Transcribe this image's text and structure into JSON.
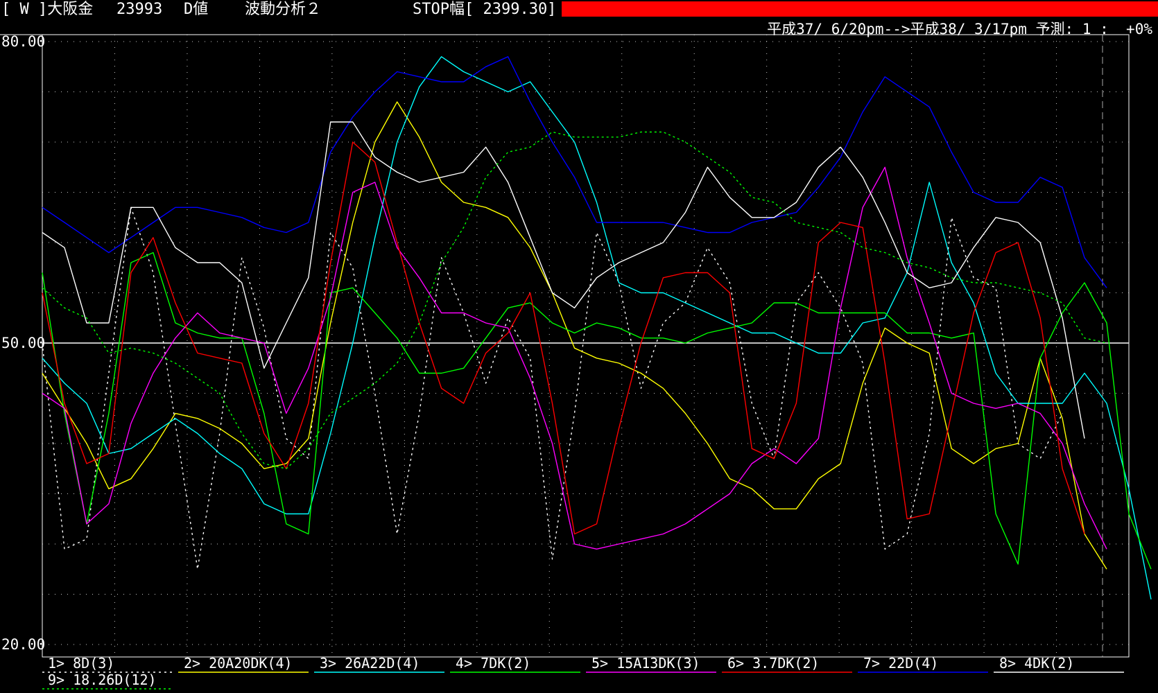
{
  "header": {
    "code": "[ W ]大阪金",
    "number": "23993",
    "mode": "D値",
    "analysis": "波動分析２",
    "stop_label": "STOP幅[ 2399.30]",
    "stop_color": "#ff0000",
    "period": "平成37/ 6/20pm-->平成38/ 3/17pm 予測: 1 :  +0%"
  },
  "chart_data": {
    "type": "line",
    "title": "",
    "xlabel": "",
    "ylabel": "",
    "ylim": [
      20,
      80
    ],
    "yticks": [
      "80.00",
      "50.00",
      "20.00"
    ],
    "reference_line": 50,
    "grid": "dotted",
    "legend_position": "bottom",
    "n_points": 50,
    "series": [
      {
        "name": "1> 8D(3)",
        "color": "#ffffff",
        "dash": "3,5",
        "values": [
          50,
          29.5,
          30.5,
          47,
          63.5,
          57,
          42,
          27.5,
          41,
          58.5,
          51.5,
          40.5,
          38.5,
          61,
          57.5,
          45,
          31,
          43,
          58.5,
          53,
          46,
          52.5,
          48.5,
          28.5,
          43,
          61,
          56,
          45.5,
          52,
          54,
          59.5,
          56,
          44,
          38.5,
          54,
          57,
          53.5,
          48,
          29.5,
          31,
          41,
          62.5,
          56.5,
          55.5,
          40,
          38.5,
          43
        ]
      },
      {
        "name": "2> 20A20DK(4)",
        "color": "#ffff00",
        "dash": "",
        "values": [
          47,
          43.5,
          40,
          35.5,
          36.5,
          39.5,
          43,
          42.5,
          41.5,
          40,
          37.5,
          38,
          40.5,
          52,
          62,
          70,
          74,
          70.5,
          66,
          64,
          63.5,
          62.5,
          59.5,
          55,
          49.5,
          48.5,
          48,
          47,
          45.5,
          43,
          40,
          36.5,
          35.5,
          33.5,
          33.5,
          36.5,
          38,
          46,
          51.5,
          50,
          49,
          39.5,
          38,
          39.5,
          40,
          48.5,
          42.5,
          31,
          27.5
        ]
      },
      {
        "name": "3> 26A22D(4)",
        "color": "#00ffff",
        "dash": "",
        "values": [
          48.5,
          46,
          44,
          39,
          39.5,
          41,
          42.5,
          41,
          39,
          37.5,
          34,
          33,
          33,
          41,
          50,
          60.5,
          70,
          75.5,
          78.5,
          77,
          76,
          75,
          76,
          73,
          70,
          64,
          56,
          55,
          55,
          54,
          53,
          52,
          51,
          51,
          50,
          49,
          49,
          52,
          52.5,
          57,
          66,
          58,
          54,
          47,
          44,
          44,
          44,
          47,
          44,
          35.5,
          24.5
        ]
      },
      {
        "name": "4> 7DK(2)",
        "color": "#00ff00",
        "dash": "",
        "values": [
          57,
          43,
          32,
          43,
          58,
          59,
          52,
          51,
          50.5,
          50.5,
          43,
          32,
          31,
          55,
          55.5,
          53,
          50.5,
          47,
          47,
          47.5,
          50.5,
          53.5,
          54,
          52,
          51,
          52,
          51.5,
          50.5,
          50.5,
          50,
          51,
          51.5,
          52,
          54,
          54,
          53,
          53,
          53,
          53,
          51,
          51,
          50.5,
          51,
          33,
          28,
          48.5,
          53,
          56,
          52,
          33,
          27.5
        ]
      },
      {
        "name": "5> 15A13DK(3)",
        "color": "#ff00ff",
        "dash": "",
        "values": [
          45,
          43.5,
          32,
          34,
          42,
          47,
          50.5,
          53,
          51,
          50.5,
          50,
          43,
          47.5,
          54.5,
          65,
          66,
          59.5,
          56.5,
          53,
          53,
          52,
          51.5,
          46.5,
          40,
          30,
          29.5,
          30,
          30.5,
          31,
          32,
          33.5,
          35,
          38,
          39.5,
          38,
          40.5,
          53.5,
          63.5,
          67.5,
          58.5,
          52,
          45,
          44,
          43.5,
          44,
          43,
          40,
          34,
          29.5
        ]
      },
      {
        "name": "6> 3.7DK(2)",
        "color": "#ff0000",
        "dash": "",
        "values": [
          55,
          44,
          38,
          39,
          57,
          60.5,
          54,
          49,
          48.5,
          48,
          41,
          37.5,
          44,
          58,
          70,
          68,
          60,
          52,
          45.5,
          44,
          49,
          51,
          55,
          44,
          31,
          32,
          41.5,
          50,
          56.5,
          57,
          57,
          55,
          39.5,
          38.5,
          44,
          60,
          62,
          61.5,
          48,
          32.5,
          33,
          43,
          53,
          59,
          60,
          52.5,
          37.5,
          31
        ]
      },
      {
        "name": "7> 22D(4)",
        "color": "#0000ff",
        "dash": "",
        "values": [
          63.5,
          62,
          60.5,
          59,
          60.5,
          62,
          63.5,
          63.5,
          63,
          62.5,
          61.5,
          61,
          62,
          69,
          72.5,
          75,
          77,
          76.5,
          76,
          76,
          77.5,
          78.5,
          74,
          70,
          66.5,
          62,
          62,
          62,
          62,
          61.5,
          61,
          61,
          62,
          62.5,
          63,
          65.5,
          68.5,
          73,
          76.5,
          75,
          73.5,
          69,
          65,
          64,
          64,
          66.5,
          65.5,
          58.5,
          55.5
        ]
      },
      {
        "name": "8> 4DK(2)",
        "color": "#ffffff",
        "dash": "",
        "values": [
          61,
          59.5,
          52,
          52,
          63.5,
          63.5,
          59.5,
          58,
          58,
          56,
          47.5,
          52,
          56.5,
          72,
          72,
          68.5,
          67,
          66,
          66.5,
          67,
          69.5,
          66,
          60.5,
          55,
          53.5,
          56.5,
          58,
          59,
          60,
          63,
          67.5,
          64.5,
          62.5,
          62.5,
          64,
          67.5,
          69.5,
          66.5,
          62,
          57,
          55.5,
          56,
          59.5,
          62.5,
          62,
          60,
          52.5,
          40.5
        ]
      },
      {
        "name": "9> 18.26D(12)",
        "color": "#00ff00",
        "dash": "3,4",
        "values": [
          55.5,
          53.5,
          52.5,
          49,
          49.5,
          49,
          48,
          46.5,
          45,
          41,
          38,
          37.5,
          39.5,
          43,
          44.5,
          46,
          48,
          52,
          58,
          61.5,
          66.5,
          69,
          69.5,
          71,
          70.5,
          70.5,
          70.5,
          71,
          71,
          70,
          68.5,
          67,
          64.5,
          64,
          62,
          61.5,
          61,
          59.5,
          59,
          58,
          57.5,
          56.5,
          56,
          56,
          55.5,
          55,
          54,
          50.5,
          50
        ]
      }
    ]
  }
}
